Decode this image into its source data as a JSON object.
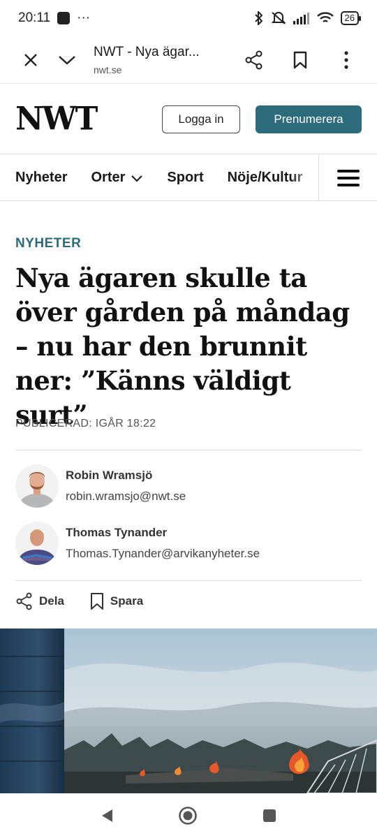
{
  "status_bar": {
    "time": "20:11",
    "dots": "···",
    "battery": "26"
  },
  "browser": {
    "title": "NWT - Nya ägar...",
    "domain": "nwt.se"
  },
  "site": {
    "logo": "NWT",
    "login_label": "Logga in",
    "subscribe_label": "Prenumerera",
    "accent_color": "#2b6b7b"
  },
  "nav": {
    "items": [
      {
        "label": "Nyheter"
      },
      {
        "label": "Orter"
      },
      {
        "label": "Sport"
      },
      {
        "label": "Nöje/Kultur"
      }
    ]
  },
  "article": {
    "category": "NYHETER",
    "headline": "Nya ägaren skulle ta över gården på måndag – nu har den brunnit ner: ”Känns väldigt surt”",
    "published": "PUBLICERAD: IGÅR 18:22",
    "authors": [
      {
        "name": "Robin Wramsjö",
        "email": "robin.wramsjo@nwt.se"
      },
      {
        "name": "Thomas Tynander",
        "email": "Thomas.Tynander@arvikanyheter.se"
      }
    ],
    "share_label": "Dela",
    "save_label": "Spara"
  }
}
